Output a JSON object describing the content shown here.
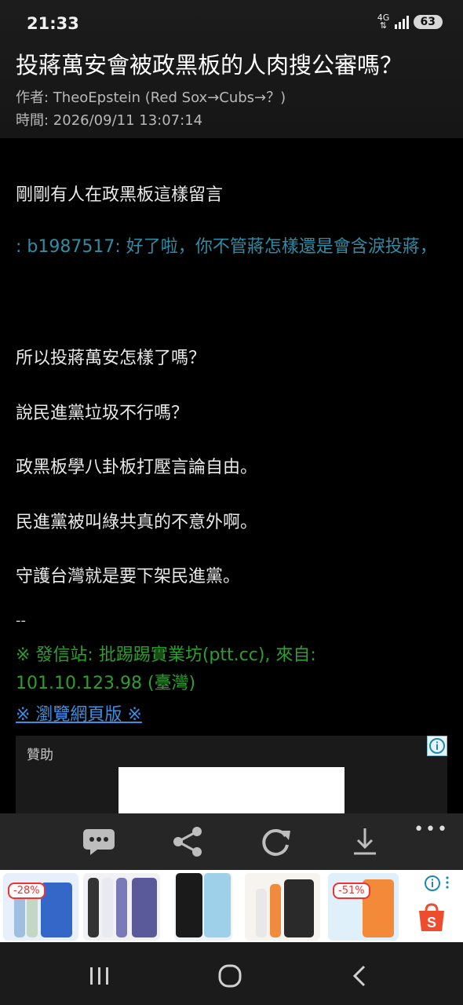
{
  "status": {
    "time": "21:33",
    "network": "4G",
    "battery": "63"
  },
  "header": {
    "title": "投蔣萬安會被政黑板的人肉搜公審嗎？",
    "author": "作者: TheoEpstein (Red Sox→Cubs→？)",
    "time": "時間: 2026/09/11 13:07:14"
  },
  "post": {
    "line1": "剛剛有人在政黑板這樣留言",
    "quote": ": b1987517: 好了啦，你不管蔣怎樣還是會含淚投蔣，",
    "line2": "所以投蔣萬安怎樣了嗎？",
    "line3": "說民進黨垃圾不行嗎？",
    "line4": "政黑板學八卦板打壓言論自由。",
    "line5": "民進黨被叫綠共真的不意外啊。",
    "line6": "守護台灣就是要下架民進黨。",
    "dash": "--",
    "signature": "※ 發信站: 批踢踢實業坊(ptt.cc), 來自: 101.10.123.98 (臺灣)",
    "browse_link": "※ 瀏覽網頁版 ※"
  },
  "sponsor": {
    "label": "贊助"
  },
  "toolbar": {
    "more": "•••"
  },
  "ads": {
    "badge1": "-28%",
    "badge2": "-51%"
  },
  "colors": {
    "quote": "#2f8da6",
    "signature": "#2e9e2e",
    "link": "#3d8fe0"
  },
  "icons": [
    "comment-icon",
    "share-icon",
    "refresh-icon",
    "download-icon",
    "info-icon",
    "shopee-icon",
    "recent-apps-icon",
    "home-icon",
    "back-icon"
  ]
}
